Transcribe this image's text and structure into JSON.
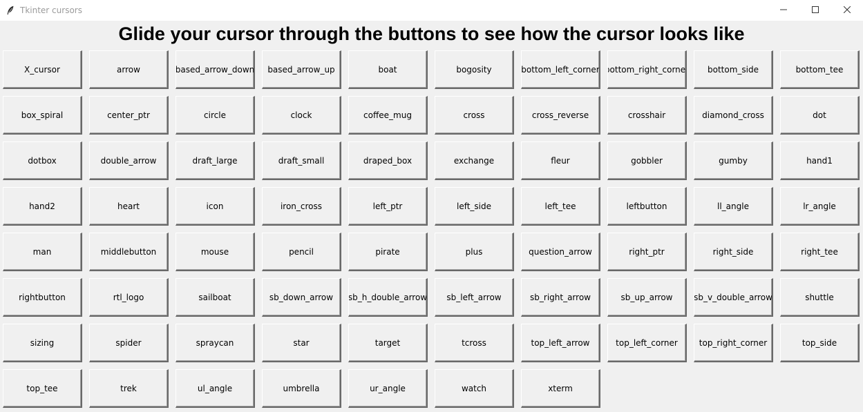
{
  "window": {
    "title": "Tkinter cursors",
    "icons": {
      "app": "feather-icon",
      "minimize": "minimize-icon",
      "maximize": "maximize-icon",
      "close": "close-icon"
    }
  },
  "heading": "Glide your cursor through the buttons to see how the cursor looks like",
  "buttons": [
    "X_cursor",
    "arrow",
    "based_arrow_down",
    "based_arrow_up",
    "boat",
    "bogosity",
    "bottom_left_corner",
    "bottom_right_corner",
    "bottom_side",
    "bottom_tee",
    "box_spiral",
    "center_ptr",
    "circle",
    "clock",
    "coffee_mug",
    "cross",
    "cross_reverse",
    "crosshair",
    "diamond_cross",
    "dot",
    "dotbox",
    "double_arrow",
    "draft_large",
    "draft_small",
    "draped_box",
    "exchange",
    "fleur",
    "gobbler",
    "gumby",
    "hand1",
    "hand2",
    "heart",
    "icon",
    "iron_cross",
    "left_ptr",
    "left_side",
    "left_tee",
    "leftbutton",
    "ll_angle",
    "lr_angle",
    "man",
    "middlebutton",
    "mouse",
    "pencil",
    "pirate",
    "plus",
    "question_arrow",
    "right_ptr",
    "right_side",
    "right_tee",
    "rightbutton",
    "rtl_logo",
    "sailboat",
    "sb_down_arrow",
    "sb_h_double_arrow",
    "sb_left_arrow",
    "sb_right_arrow",
    "sb_up_arrow",
    "sb_v_double_arrow",
    "shuttle",
    "sizing",
    "spider",
    "spraycan",
    "star",
    "target",
    "tcross",
    "top_left_arrow",
    "top_left_corner",
    "top_right_corner",
    "top_side",
    "top_tee",
    "trek",
    "ul_angle",
    "umbrella",
    "ur_angle",
    "watch",
    "xterm"
  ]
}
